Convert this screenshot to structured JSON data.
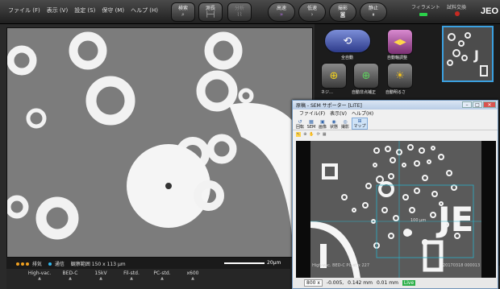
{
  "menu": [
    "ファイル (F)",
    "表示 (V)",
    "設定 (S)",
    "保守 (M)",
    "ヘルプ (H)"
  ],
  "toolbar": {
    "search": "検索",
    "measure": "測長",
    "analysis": "分析",
    "scan_fast": "高速",
    "scan_slow": "低速",
    "capture": "撮影",
    "stop": "静止"
  },
  "status": {
    "filament": "フィラメント",
    "vacuum": "試料交換"
  },
  "logo": "JEO",
  "right_panel": {
    "auto_all": "全自動",
    "auto_focus": "自動軸調整",
    "auto_contrast": "ネジ…",
    "auto_stig": "自動非点補正",
    "auto_brightness": "自動明るさ"
  },
  "info": {
    "evac": "排気",
    "evac_color": "#f0a020",
    "comm": "通信",
    "comm_color": "#30b8f0",
    "fov": "観察範囲 150 x 113 μm",
    "scale": "20μm"
  },
  "conditions": [
    {
      "value": "High-vac.",
      "arrow": "▲"
    },
    {
      "value": "BED-C",
      "arrow": "▲"
    },
    {
      "value": "15kV",
      "arrow": "▲"
    },
    {
      "value": "Fil-std.",
      "arrow": "▲"
    },
    {
      "value": "PC-std.",
      "arrow": "▲"
    },
    {
      "value": "x600",
      "arrow": "▲"
    }
  ],
  "window": {
    "title": "原稿 - SEM サポーター [LITE]",
    "menu": [
      "ファイル(F)",
      "表示(V)",
      "ヘルプ(H)"
    ],
    "tools": [
      {
        "icon": "↺",
        "label": "回転"
      },
      {
        "icon": "▦",
        "label": "SEM"
      },
      {
        "icon": "▣",
        "label": "画像"
      },
      {
        "icon": "◉",
        "label": "状態"
      },
      {
        "icon": "◎",
        "label": "撮影"
      },
      {
        "icon": "⊞",
        "label": "マップ"
      }
    ],
    "img_overlay": "High-vac.   BED-C   PC-st   x 227",
    "img_id": "20170318  000013",
    "img_scale": "100 μm",
    "status": {
      "zoom": "800 x",
      "x": "-0.005,",
      "y": "0.142 mm",
      "z": "0.01 mm",
      "live": "Live"
    }
  }
}
